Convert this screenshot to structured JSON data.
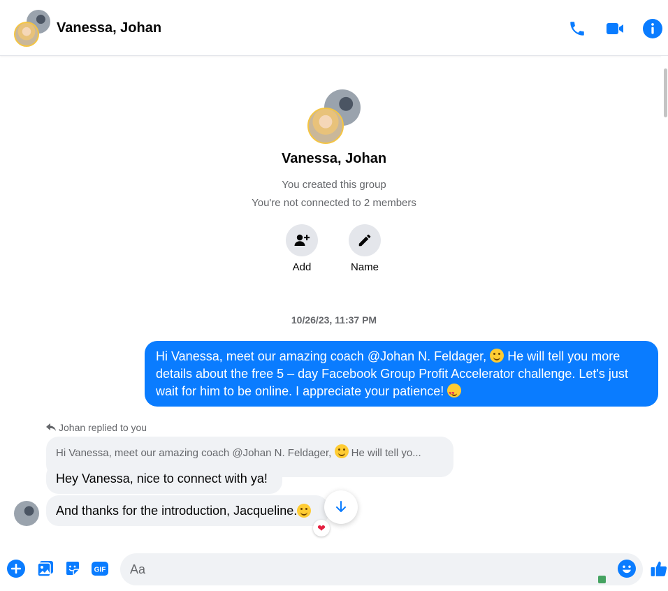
{
  "header": {
    "title": "Vanessa, Johan",
    "icons": [
      "phone-icon",
      "video-camera-icon",
      "info-icon"
    ]
  },
  "intro": {
    "name": "Vanessa, Johan",
    "created": "You created this group",
    "connection": "You're not connected to 2 members",
    "actions": [
      {
        "label": "Add",
        "icon": "add-person-icon"
      },
      {
        "label": "Name",
        "icon": "pencil-icon"
      }
    ]
  },
  "timestamp": "10/26/23, 11:37 PM",
  "messages": {
    "outgoing": {
      "part1": "Hi Vanessa, meet our amazing coach @Johan N. Feldager, ",
      "part2": " He will tell you more details about the free 5 – day Facebook Group Profit Accelerator challenge. Let's just wait for him to be online. I appreciate your patience! "
    },
    "reply_label": "Johan replied to you",
    "quoted": {
      "part1": "Hi Vanessa, meet our amazing coach @Johan N. Feldager, ",
      "part2": " He will tell yo..."
    },
    "incoming": [
      {
        "text": "Hey Vanessa, nice to connect with ya!"
      },
      {
        "text": "And thanks for the introduction, Jacqueline. "
      }
    ],
    "reaction": "❤"
  },
  "composer": {
    "placeholder": "Aa",
    "icons": [
      "plus-icon",
      "image-icon",
      "sticker-icon",
      "gif-icon",
      "emoji-icon",
      "thumbs-up-icon"
    ],
    "gif_label": "GIF"
  },
  "colors": {
    "accent": "#0a7cff",
    "bubble_in": "#f0f2f5",
    "muted": "#65676b"
  }
}
